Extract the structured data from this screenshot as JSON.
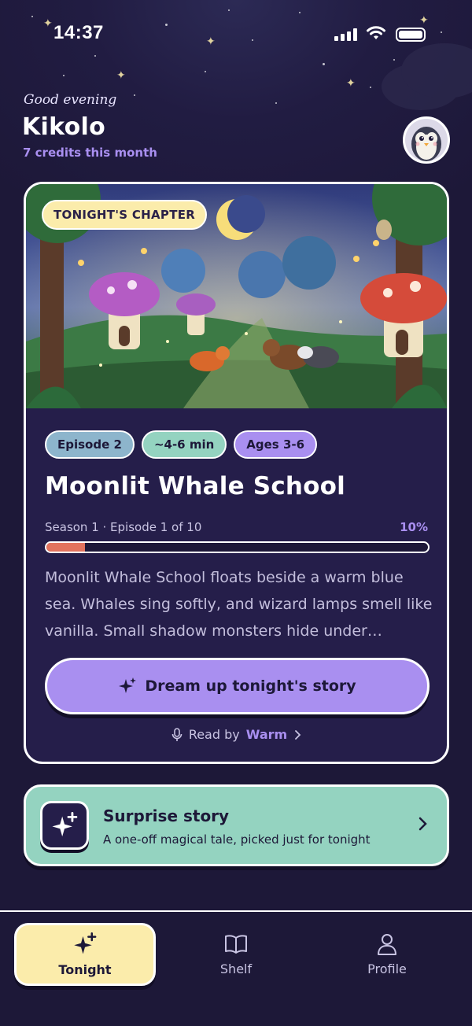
{
  "status_bar": {
    "time": "14:37"
  },
  "header": {
    "greeting": "Good evening",
    "name": "Kikolo",
    "credits": "7 credits this month",
    "avatar_icon": "penguin-avatar"
  },
  "chapter_card": {
    "badge": "TONIGHT'S CHAPTER",
    "chips": [
      {
        "label": "Episode 2",
        "color": "#8db5cc"
      },
      {
        "label": "~4-6 min",
        "color": "#94d3c0"
      },
      {
        "label": "Ages 3-6",
        "color": "#a98ff0"
      }
    ],
    "title": "Moonlit Whale School",
    "progress_label": "Season 1 · Episode 1 of 10",
    "progress_percent_text": "10%",
    "progress_value": 0.1,
    "description": "Moonlit Whale School floats beside a warm blue sea. Whales sing softly, and wizard lamps smell like vanilla. Small shadow monsters hide under…",
    "cta_label": "Dream up tonight's story",
    "read_by_label": "Read by",
    "voice": "Warm"
  },
  "surprise": {
    "title": "Surprise story",
    "subtitle": "A one-off magical tale, picked just for tonight"
  },
  "tabs": [
    {
      "label": "Tonight",
      "icon": "sparkles-icon",
      "active": true
    },
    {
      "label": "Shelf",
      "icon": "book-icon",
      "active": false
    },
    {
      "label": "Profile",
      "icon": "person-icon",
      "active": false
    }
  ],
  "colors": {
    "background": "#1d1838",
    "card": "#251e4a",
    "accent_purple": "#a98ff0",
    "accent_yellow": "#fbecab",
    "accent_mint": "#94d3c0",
    "progress_fill": "#e2735e"
  }
}
